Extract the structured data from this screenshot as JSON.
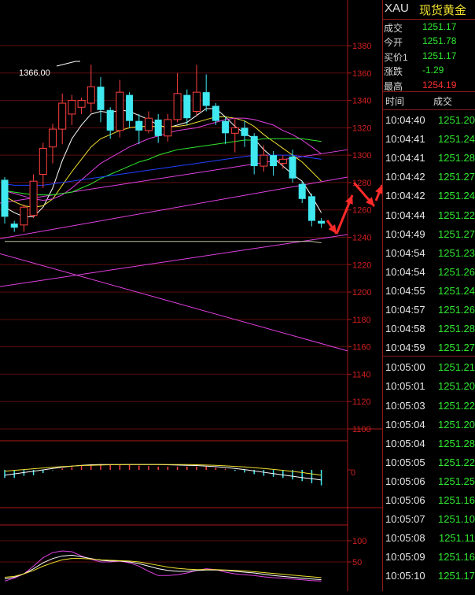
{
  "quote": {
    "symbol": "XAU",
    "name": "现货黄金",
    "rows": [
      {
        "label": "成交",
        "value": "1251.17",
        "color": "#30e830"
      },
      {
        "label": "今开",
        "value": "1251.78",
        "color": "#30e830"
      },
      {
        "label": "买价1",
        "value": "1251.17",
        "color": "#30e830"
      },
      {
        "label": "涨跌",
        "value": "-1.29",
        "color": "#30e830"
      },
      {
        "label": "最高",
        "value": "1254.19",
        "color": "#ff3030"
      }
    ]
  },
  "ticks": {
    "time_header": "时间",
    "price_header": "成交",
    "rows": [
      {
        "time": "10:04:40",
        "price": "1251.20"
      },
      {
        "time": "10:04:41",
        "price": "1251.24"
      },
      {
        "time": "10:04:41",
        "price": "1251.28"
      },
      {
        "time": "10:04:42",
        "price": "1251.27"
      },
      {
        "time": "10:04:42",
        "price": "1251.24"
      },
      {
        "time": "10:04:44",
        "price": "1251.22"
      },
      {
        "time": "10:04:49",
        "price": "1251.27"
      },
      {
        "time": "10:04:54",
        "price": "1251.23"
      },
      {
        "time": "10:04:54",
        "price": "1251.26"
      },
      {
        "time": "10:04:55",
        "price": "1251.24"
      },
      {
        "time": "10:04:57",
        "price": "1251.26"
      },
      {
        "time": "10:04:58",
        "price": "1251.28"
      },
      {
        "time": "10:04:59",
        "price": "1251.27"
      },
      {
        "time": "10:05:00",
        "price": "1251.21"
      },
      {
        "time": "10:05:01",
        "price": "1251.20"
      },
      {
        "time": "10:05:03",
        "price": "1251.22"
      },
      {
        "time": "10:05:04",
        "price": "1251.20"
      },
      {
        "time": "10:05:04",
        "price": "1251.28"
      },
      {
        "time": "10:05:05",
        "price": "1251.22"
      },
      {
        "time": "10:05:06",
        "price": "1251.25"
      },
      {
        "time": "10:05:06",
        "price": "1251.16"
      },
      {
        "time": "10:05:07",
        "price": "1251.10"
      },
      {
        "time": "10:05:08",
        "price": "1251.11"
      },
      {
        "time": "10:05:09",
        "price": "1251.16"
      },
      {
        "time": "10:05:10",
        "price": "1251.17"
      }
    ]
  },
  "chart_data": [
    {
      "type": "candlestick",
      "ylim": [
        1100,
        1390
      ],
      "y_ticks": [
        1380,
        1360,
        1340,
        1320,
        1300,
        1280,
        1260,
        1240,
        1220,
        1200,
        1180,
        1160,
        1140,
        1120,
        1100
      ],
      "annotation": "1366.00",
      "annotation_value": 1366,
      "grid": true,
      "candles": [
        {
          "o": 1282,
          "c": 1255,
          "h": 1284,
          "l": 1250
        },
        {
          "o": 1250,
          "c": 1247,
          "h": 1252,
          "l": 1244
        },
        {
          "o": 1249,
          "c": 1262,
          "h": 1264,
          "l": 1244
        },
        {
          "o": 1256,
          "c": 1281,
          "h": 1286,
          "l": 1254
        },
        {
          "o": 1286,
          "c": 1305,
          "h": 1309,
          "l": 1276
        },
        {
          "o": 1306,
          "c": 1319,
          "h": 1323,
          "l": 1294
        },
        {
          "o": 1319,
          "c": 1338,
          "h": 1345,
          "l": 1308
        },
        {
          "o": 1330,
          "c": 1340,
          "h": 1344,
          "l": 1322
        },
        {
          "o": 1335,
          "c": 1340,
          "h": 1342,
          "l": 1330
        },
        {
          "o": 1338,
          "c": 1350,
          "h": 1366,
          "l": 1331
        },
        {
          "o": 1350,
          "c": 1333,
          "h": 1357,
          "l": 1324
        },
        {
          "o": 1333,
          "c": 1318,
          "h": 1335,
          "l": 1312
        },
        {
          "o": 1318,
          "c": 1346,
          "h": 1355,
          "l": 1313
        },
        {
          "o": 1344,
          "c": 1325,
          "h": 1346,
          "l": 1320
        },
        {
          "o": 1325,
          "c": 1318,
          "h": 1330,
          "l": 1308
        },
        {
          "o": 1318,
          "c": 1327,
          "h": 1332,
          "l": 1316
        },
        {
          "o": 1326,
          "c": 1314,
          "h": 1330,
          "l": 1309
        },
        {
          "o": 1314,
          "c": 1326,
          "h": 1330,
          "l": 1310
        },
        {
          "o": 1326,
          "c": 1345,
          "h": 1360,
          "l": 1324
        },
        {
          "o": 1344,
          "c": 1327,
          "h": 1348,
          "l": 1322
        },
        {
          "o": 1332,
          "c": 1346,
          "h": 1366,
          "l": 1329
        },
        {
          "o": 1346,
          "c": 1336,
          "h": 1359,
          "l": 1332
        },
        {
          "o": 1336,
          "c": 1325,
          "h": 1338,
          "l": 1322
        },
        {
          "o": 1325,
          "c": 1316,
          "h": 1328,
          "l": 1308
        },
        {
          "o": 1316,
          "c": 1320,
          "h": 1327,
          "l": 1302
        },
        {
          "o": 1320,
          "c": 1314,
          "h": 1325,
          "l": 1306
        },
        {
          "o": 1314,
          "c": 1292,
          "h": 1316,
          "l": 1286
        },
        {
          "o": 1292,
          "c": 1300,
          "h": 1307,
          "l": 1288
        },
        {
          "o": 1300,
          "c": 1292,
          "h": 1303,
          "l": 1285
        },
        {
          "o": 1294,
          "c": 1297,
          "h": 1300,
          "l": 1290
        },
        {
          "o": 1299,
          "c": 1283,
          "h": 1304,
          "l": 1280
        },
        {
          "o": 1279,
          "c": 1268,
          "h": 1281,
          "l": 1265
        },
        {
          "o": 1270,
          "c": 1252,
          "h": 1272,
          "l": 1248
        },
        {
          "o": 1252,
          "c": 1250,
          "h": 1254,
          "l": 1247
        }
      ],
      "ma_lines": [
        {
          "color": "#ffffff",
          "values": [
            1262,
            1258,
            1255,
            1255,
            1262,
            1276,
            1296,
            1312,
            1322,
            1330,
            1332,
            1331,
            1333,
            1332,
            1329,
            1326,
            1322,
            1320,
            1322,
            1324,
            1329,
            1334,
            1334,
            1328,
            1321,
            1316,
            1312,
            1304,
            1298,
            1292,
            1286,
            1281,
            1270,
            1258
          ]
        },
        {
          "color": "#f0e030",
          "values": [
            1270,
            1266,
            1263,
            1262,
            1263,
            1268,
            1278,
            1288,
            1297,
            1306,
            1312,
            1315,
            1318,
            1320,
            1321,
            1321,
            1321,
            1321,
            1321,
            1322,
            1324,
            1326,
            1328,
            1328,
            1327,
            1325,
            1321,
            1315,
            1310,
            1305,
            1300,
            1295,
            1288,
            1281
          ]
        },
        {
          "color": "#e040e0",
          "values": [
            1274,
            1272,
            1270,
            1268,
            1267,
            1268,
            1271,
            1276,
            1282,
            1288,
            1294,
            1298,
            1302,
            1306,
            1309,
            1312,
            1314,
            1316,
            1318,
            1319,
            1320,
            1322,
            1324,
            1326,
            1327,
            1327,
            1326,
            1324,
            1322,
            1318,
            1315,
            1311,
            1306,
            1301
          ]
        },
        {
          "color": "#30e830",
          "values": [
            1274,
            1273,
            1272,
            1271,
            1271,
            1271,
            1272,
            1273,
            1276,
            1279,
            1283,
            1286,
            1289,
            1292,
            1295,
            1297,
            1300,
            1302,
            1304,
            1305,
            1306,
            1307,
            1308,
            1309,
            1310,
            1311,
            1311,
            1312,
            1312,
            1312,
            1312,
            1312,
            1311,
            1310
          ]
        },
        {
          "color": "#2040ff",
          "values": [
            1279,
            1278,
            1278,
            1278,
            1278,
            1279,
            1280,
            1281,
            1282,
            1283,
            1284,
            1285,
            1286,
            1287,
            1288,
            1289,
            1290,
            1291,
            1292,
            1293,
            1294,
            1295,
            1296,
            1297,
            1298,
            1299,
            1300,
            1300,
            1300,
            1300,
            1300,
            1299,
            1298,
            1297
          ]
        },
        {
          "color": "#c0c0a0",
          "values": [
            1237,
            1237,
            1237,
            1237,
            1237,
            1237,
            1237,
            1237,
            1237,
            1237,
            1237,
            1237,
            1237,
            1237,
            1237,
            1237,
            1237,
            1237,
            1237,
            1237,
            1237,
            1237,
            1237,
            1237,
            1237,
            1237,
            1237,
            1237,
            1237,
            1237,
            1237,
            1237,
            1237,
            1236
          ]
        }
      ],
      "trend_lines": [
        {
          "x0": 0,
          "y0": 1265,
          "x1": 34,
          "y1": 1304
        },
        {
          "x0": 0,
          "y0": 1239,
          "x1": 34,
          "y1": 1284
        },
        {
          "x0": 0,
          "y0": 1204,
          "x1": 34,
          "y1": 1242
        },
        {
          "x0": 0,
          "y0": 1228,
          "x1": 34,
          "y1": 1157
        }
      ]
    },
    {
      "type": "bar",
      "ylim": [
        -1,
        1
      ],
      "y_ticks": [
        0
      ],
      "values": [
        -0.3,
        -0.3,
        -0.22,
        -0.2,
        -0.12,
        -0.02,
        0.05,
        0.1,
        0.15,
        0.2,
        0.22,
        0.2,
        0.18,
        0.18,
        0.16,
        0.14,
        0.12,
        0.12,
        0.12,
        0.12,
        0.12,
        0.12,
        0.08,
        0.04,
        -0.04,
        -0.1,
        -0.16,
        -0.22,
        -0.26,
        -0.3,
        -0.36,
        -0.42,
        -0.5,
        -0.58
      ],
      "lines": [
        {
          "color": "#ffffff",
          "values": [
            -0.2,
            -0.15,
            -0.1,
            -0.05,
            0.0,
            0.05,
            0.1,
            0.14,
            0.17,
            0.19,
            0.2,
            0.2,
            0.2,
            0.2,
            0.2,
            0.2,
            0.2,
            0.19,
            0.18,
            0.17,
            0.16,
            0.14,
            0.12,
            0.09,
            0.05,
            0.01,
            -0.04,
            -0.09,
            -0.14,
            -0.19,
            -0.24,
            -0.29,
            -0.33,
            -0.38
          ]
        },
        {
          "color": "#f0e030",
          "values": [
            -0.05,
            -0.02,
            0.01,
            0.04,
            0.07,
            0.1,
            0.12,
            0.14,
            0.16,
            0.17,
            0.18,
            0.19,
            0.19,
            0.2,
            0.2,
            0.2,
            0.2,
            0.2,
            0.2,
            0.2,
            0.19,
            0.18,
            0.17,
            0.15,
            0.13,
            0.11,
            0.08,
            0.05,
            0.02,
            -0.02,
            -0.06,
            -0.1,
            -0.15,
            -0.2
          ]
        }
      ]
    },
    {
      "type": "line",
      "ylim": [
        0,
        120
      ],
      "y_ticks": [
        100,
        50
      ],
      "series": [
        {
          "color": "#e040e0",
          "values": [
            5,
            12,
            22,
            40,
            60,
            72,
            76,
            74,
            64,
            56,
            50,
            50,
            52,
            48,
            40,
            28,
            18,
            18,
            20,
            24,
            30,
            34,
            32,
            26,
            22,
            20,
            18,
            15,
            13,
            12,
            10,
            8,
            6,
            5
          ]
        },
        {
          "color": "#ffffff",
          "values": [
            10,
            14,
            22,
            34,
            48,
            58,
            64,
            66,
            62,
            58,
            54,
            52,
            52,
            50,
            46,
            40,
            34,
            30,
            28,
            28,
            30,
            31,
            31,
            30,
            28,
            26,
            24,
            21,
            18,
            16,
            14,
            12,
            10,
            8
          ]
        },
        {
          "color": "#f0e030",
          "values": [
            14,
            16,
            22,
            30,
            40,
            48,
            55,
            58,
            58,
            57,
            55,
            54,
            53,
            52,
            50,
            46,
            42,
            38,
            35,
            33,
            32,
            32,
            32,
            31,
            30,
            29,
            27,
            25,
            23,
            21,
            19,
            17,
            15,
            13
          ]
        }
      ]
    }
  ]
}
